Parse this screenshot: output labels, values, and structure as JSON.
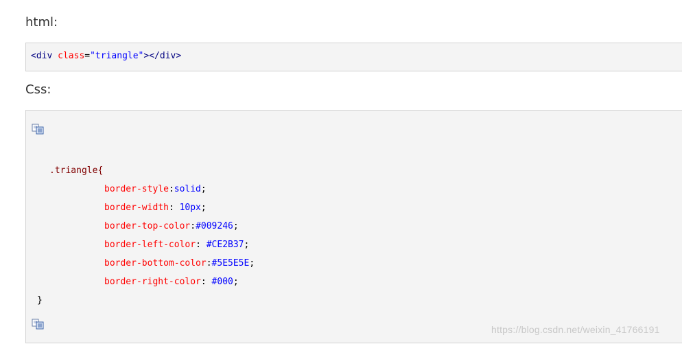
{
  "headings": {
    "html": "html:",
    "css": "Css:"
  },
  "html_code": {
    "open_tag": "<div",
    "attr_name": "class",
    "equals": "=",
    "attr_value": "\"triangle\"",
    "close_rest": "></div>"
  },
  "css_code": {
    "selector": ".triangle{",
    "rules": [
      {
        "property": "border-style",
        "separator": ":",
        "value": "solid",
        "end": ";"
      },
      {
        "property": "border-width",
        "separator": ": ",
        "value": "10px",
        "end": ";"
      },
      {
        "property": "border-top-color",
        "separator": ":",
        "value": "#009246",
        "end": ";"
      },
      {
        "property": "border-left-color",
        "separator": ": ",
        "value": "#CE2B37",
        "end": ";"
      },
      {
        "property": "border-bottom-color",
        "separator": ":",
        "value": "#5E5E5E",
        "end": ";"
      },
      {
        "property": "border-right-color",
        "separator": ": ",
        "value": "#000",
        "end": ";"
      }
    ],
    "closing": "}"
  },
  "icons": {
    "copy_top": "copy-icon",
    "copy_bottom": "copy-icon"
  },
  "watermark": "https://blog.csdn.net/weixin_41766191",
  "colors": {
    "tag": "#000080",
    "attribute": "#ff0000",
    "string": "#0000ff",
    "selector": "#800000",
    "box_background": "#f4f4f4",
    "box_border": "#d2d2d2"
  }
}
